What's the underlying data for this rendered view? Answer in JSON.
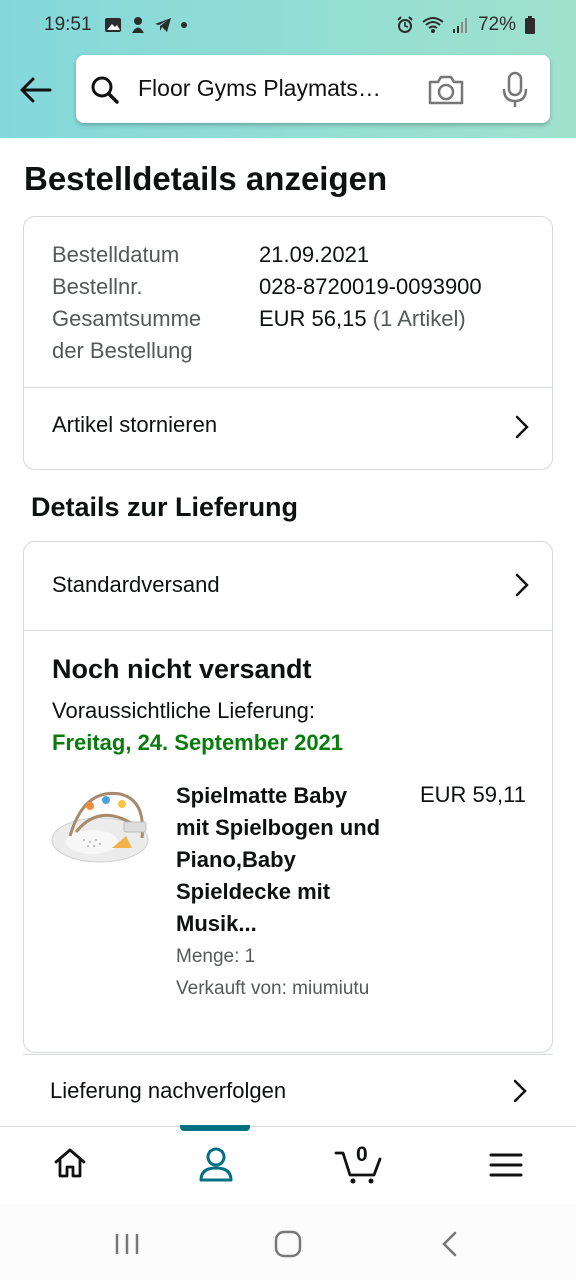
{
  "status_bar": {
    "time": "19:51",
    "battery": "72%"
  },
  "search": {
    "query": "Floor Gyms Playmats…"
  },
  "page": {
    "title": "Bestelldetails anzeigen"
  },
  "order": {
    "date_label": "Bestelldatum",
    "date_value": "21.09.2021",
    "number_label": "Bestellnr.",
    "number_value": "028-8720019-0093900",
    "total_label_1": "Gesamtsumme",
    "total_label_2": "der Bestellung",
    "total_value": "EUR 56,15",
    "total_items": "(1 Artikel)",
    "cancel_label": "Artikel stornieren"
  },
  "delivery": {
    "section_title": "Details zur Lieferung",
    "shipping_method": "Standardversand",
    "status": "Noch nicht versandt",
    "expected_label": "Voraussichtliche Lieferung:",
    "expected_date": "Freitag, 24. September 2021",
    "accent_color": "#067d0a"
  },
  "product": {
    "title_lines": [
      "Spielmatte Baby",
      "mit Spielbogen und",
      "Piano,Baby",
      "Spieldecke mit",
      "Musik..."
    ],
    "price": "EUR 59,11",
    "quantity": "Menge: 1",
    "seller": "Verkauft von: miumiutu"
  },
  "track": {
    "label": "Lieferung nachverfolgen"
  },
  "tabs": {
    "cart_count": "0",
    "active": "account",
    "active_color": "#007185"
  }
}
